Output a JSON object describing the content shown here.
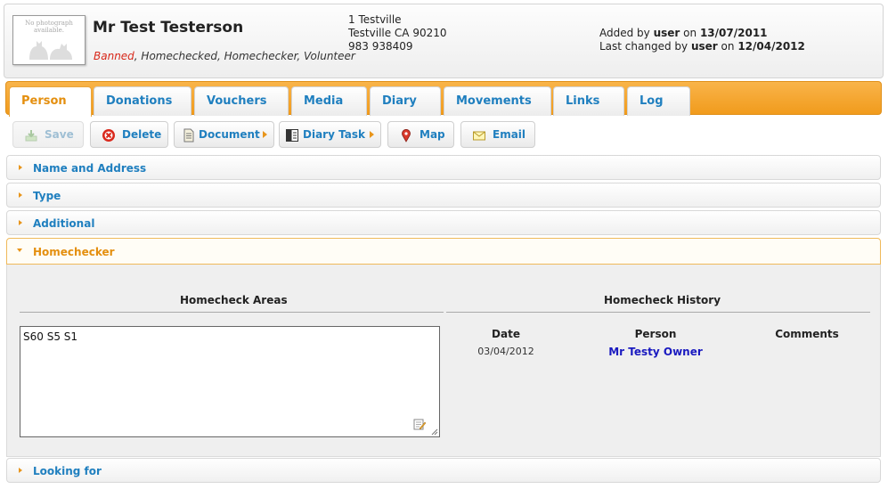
{
  "header": {
    "photo_text": "No photograph available.",
    "name": "Mr Test Testerson",
    "flags": {
      "banned": "Banned",
      "rest": ", Homechecked, Homechecker, Volunteer"
    },
    "address": {
      "line1": "1 Testville",
      "line2": "Testville CA 90210",
      "phone": "983 938409"
    },
    "added_by_label": "Added by",
    "added_by_user": "user",
    "added_on_label": "on",
    "added_on": "13/07/2011",
    "changed_by_label": "Last changed by",
    "changed_by_user": "user",
    "changed_on_label": "on",
    "changed_on": "12/04/2012"
  },
  "tabs": [
    "Person",
    "Donations",
    "Vouchers",
    "Media",
    "Diary",
    "Movements",
    "Links",
    "Log"
  ],
  "active_tab": "Person",
  "toolbar": {
    "save": "Save",
    "delete": "Delete",
    "document": "Document",
    "diary_task": "Diary Task",
    "map": "Map",
    "email": "Email"
  },
  "sections": {
    "name_address": "Name and Address",
    "type": "Type",
    "additional": "Additional",
    "homechecker": "Homechecker",
    "looking_for": "Looking for"
  },
  "homechecker": {
    "areas_title": "Homecheck Areas",
    "areas_value": "S60 S5 S1",
    "history_title": "Homecheck History",
    "columns": {
      "date": "Date",
      "person": "Person",
      "comments": "Comments"
    },
    "rows": [
      {
        "date": "03/04/2012",
        "person": "Mr Testy Owner",
        "comments": ""
      }
    ]
  },
  "colors": {
    "accent_orange": "#f19b1c",
    "link_blue": "#1f7fbf",
    "banned_red": "#d8281a"
  }
}
